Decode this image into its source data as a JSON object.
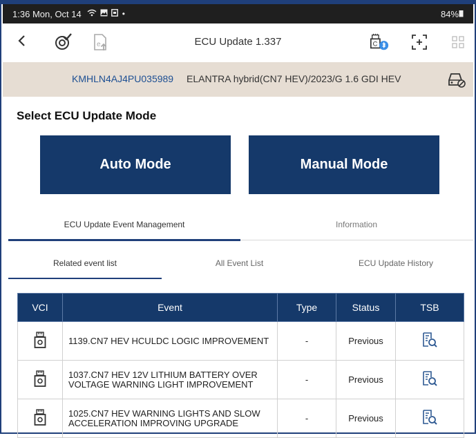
{
  "status_bar": {
    "time": "1:36",
    "date": "Mon, Oct 14",
    "icons": "wifi-icon image-icon doc-icon dot",
    "battery": "84%"
  },
  "header": {
    "title": "ECU Update 1.337",
    "icons": [
      "back-icon",
      "ecu-check-icon",
      "doc-upload-icon",
      "vci-bluetooth-icon",
      "screenshot-icon",
      "grid-icon"
    ]
  },
  "vehicle": {
    "vin": "KMHLN4AJ4PU035989",
    "model": "ELANTRA hybrid(CN7 HEV)/2023/G 1.6 GDI HEV"
  },
  "mode_section": {
    "title": "Select ECU Update Mode",
    "auto_label": "Auto Mode",
    "manual_label": "Manual Mode"
  },
  "main_tabs": {
    "event_management": "ECU Update Event Management",
    "information": "Information",
    "active": "event_management"
  },
  "sub_tabs": {
    "related": "Related event list",
    "all": "All Event List",
    "history": "ECU Update History",
    "active": "related"
  },
  "table": {
    "headers": {
      "vci": "VCI",
      "event": "Event",
      "type": "Type",
      "status": "Status",
      "tsb": "TSB"
    },
    "rows": [
      {
        "event": "1139.CN7 HEV HCULDC LOGIC IMPROVEMENT",
        "type": "-",
        "status": "Previous"
      },
      {
        "event": "1037.CN7 HEV 12V LITHIUM BATTERY OVER VOLTAGE WARNING LIGHT IMPROVEMENT",
        "type": "-",
        "status": "Previous"
      },
      {
        "event": "1025.CN7 HEV WARNING LIGHTS AND SLOW ACCELERATION IMPROVING UPGRADE",
        "type": "-",
        "status": "Previous"
      }
    ]
  },
  "colors": {
    "navy": "#15396a",
    "vin_blue": "#1d4f93",
    "vin_bar_bg": "#e6ddd3",
    "tab_underline": "#1f3f7a"
  }
}
